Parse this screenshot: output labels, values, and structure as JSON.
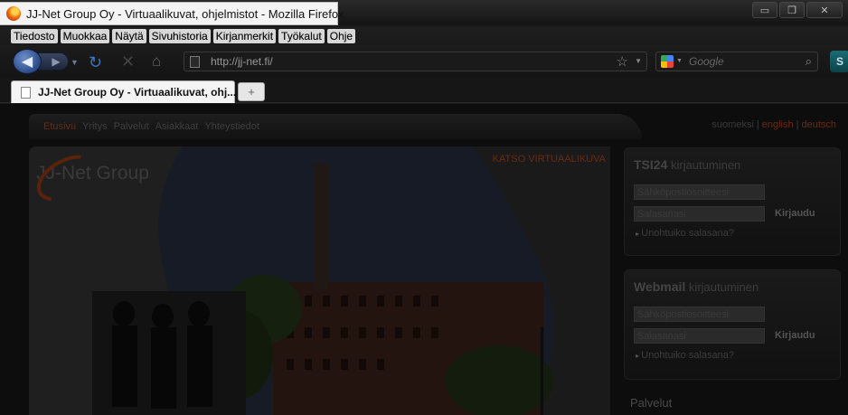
{
  "window": {
    "title": "JJ-Net Group Oy - Virtuaalikuvat, ohjelmistot - Mozilla Firefox",
    "controls": {
      "minimize": "▭",
      "restore": "❐",
      "close": "✕"
    }
  },
  "menu": {
    "items": [
      "Tiedosto",
      "Muokkaa",
      "Näytä",
      "Sivuhistoria",
      "Kirjanmerkit",
      "Työkalut",
      "Ohje"
    ]
  },
  "navbar": {
    "back_icon": "◀",
    "forward_icon": "▶",
    "history_icon": "▼",
    "reload_icon": "↻",
    "stop_icon": "✕",
    "home_icon": "⌂",
    "url": "http://jj-net.fi/",
    "bookmark_icon": "☆",
    "url_drop_icon": "▼",
    "search_placeholder": "Google",
    "search_drop_icon": "▼",
    "search_go_icon": "⌕",
    "extra_label": "S"
  },
  "tabs": {
    "active_label": "JJ-Net Group Oy - Virtuaalikuvat, ohj...",
    "new_tab_icon": "+"
  },
  "site": {
    "nav": [
      "Etusivu",
      "Yritys",
      "Palvelut",
      "Asiakkaat",
      "Yhteystiedot"
    ],
    "languages": {
      "first": "suomeksi",
      "second": "english",
      "third": "deutsch",
      "sep": "|"
    },
    "hero_cta": "KATSO VIRTUAALIKUVA",
    "logo": "JJ-Net Group",
    "tsi_panel": {
      "title_bold": "TSI24",
      "title_rest": " kirjautuminen",
      "email_placeholder": "Sähköpostiosoitteesi",
      "password_placeholder": "Salasanasi",
      "login": "Kirjaudu",
      "forgot": "Unohtuiko salasana?"
    },
    "webmail_panel": {
      "title_bold": "Webmail",
      "title_rest": " kirjautuminen",
      "email_placeholder": "Sähköpostiosoitteesi",
      "password_placeholder": "Salasanasi",
      "login": "Kirjaudu",
      "forgot": "Unohtuiko salasana?"
    },
    "services_heading": "Palvelut"
  },
  "colors": {
    "accent": "#6b2a10",
    "chrome_dark": "#141414",
    "back_button": "#2a4a86"
  }
}
